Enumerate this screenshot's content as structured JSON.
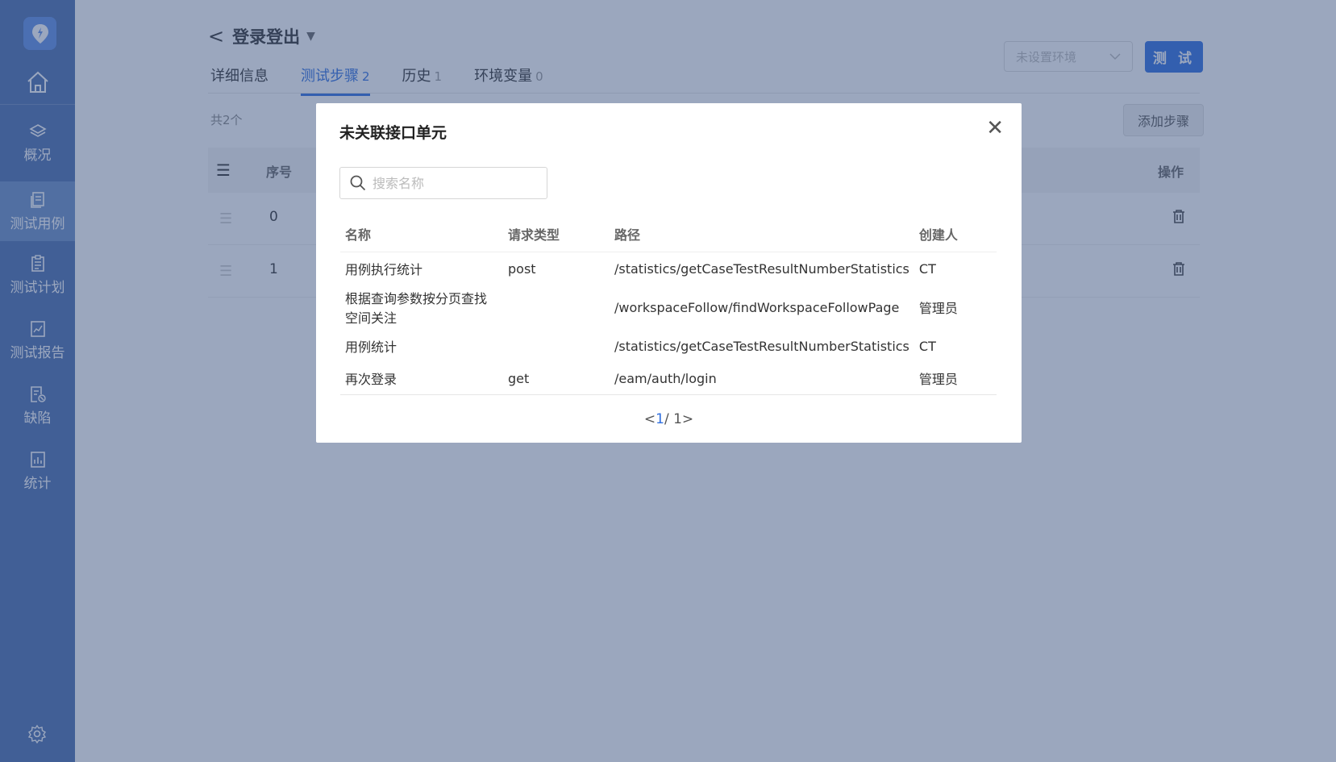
{
  "sidebar": {
    "items": [
      {
        "label": "概况"
      },
      {
        "label": "测试用例"
      },
      {
        "label": "测试计划"
      },
      {
        "label": "测试报告"
      },
      {
        "label": "缺陷"
      },
      {
        "label": "统计"
      }
    ],
    "active_index": 1
  },
  "header": {
    "back": "<",
    "title": "登录登出",
    "caret": "▼"
  },
  "tabs": [
    {
      "label": "详细信息",
      "count": ""
    },
    {
      "label": "测试步骤",
      "count": "2"
    },
    {
      "label": "历史",
      "count": "1"
    },
    {
      "label": "环境变量",
      "count": "0"
    }
  ],
  "toolbar": {
    "env_placeholder": "未设置环境",
    "test_label": "测 试"
  },
  "steps": {
    "total": "共2个",
    "add_label": "添加步骤",
    "headers": {
      "seq": "序号",
      "ops": "操作"
    },
    "rows": [
      {
        "index": "0"
      },
      {
        "index": "1"
      }
    ]
  },
  "modal": {
    "title": "未关联接口单元",
    "search_placeholder": "搜索名称",
    "columns": [
      "名称",
      "请求类型",
      "路径",
      "创建人"
    ],
    "rows": [
      {
        "name": "用例执行统计",
        "method": "post",
        "path": "/statistics/getCaseTestResultNumberStatistics",
        "creator": "CT"
      },
      {
        "name": "根据查询参数按分页查找空间关注",
        "method": "",
        "path": "/workspaceFollow/findWorkspaceFollowPage",
        "creator": "管理员"
      },
      {
        "name": "用例统计",
        "method": "",
        "path": "/statistics/getCaseTestResultNumberStatistics",
        "creator": "CT"
      },
      {
        "name": "再次登录",
        "method": "get",
        "path": "/eam/auth/login",
        "creator": "管理员"
      }
    ],
    "pager": {
      "current": "1",
      "total": "/ 1"
    }
  },
  "colors": {
    "sidebar": "#4b6eae",
    "accent": "#2f6fe0",
    "overlay": "rgba(55,80,125,0.5)"
  }
}
